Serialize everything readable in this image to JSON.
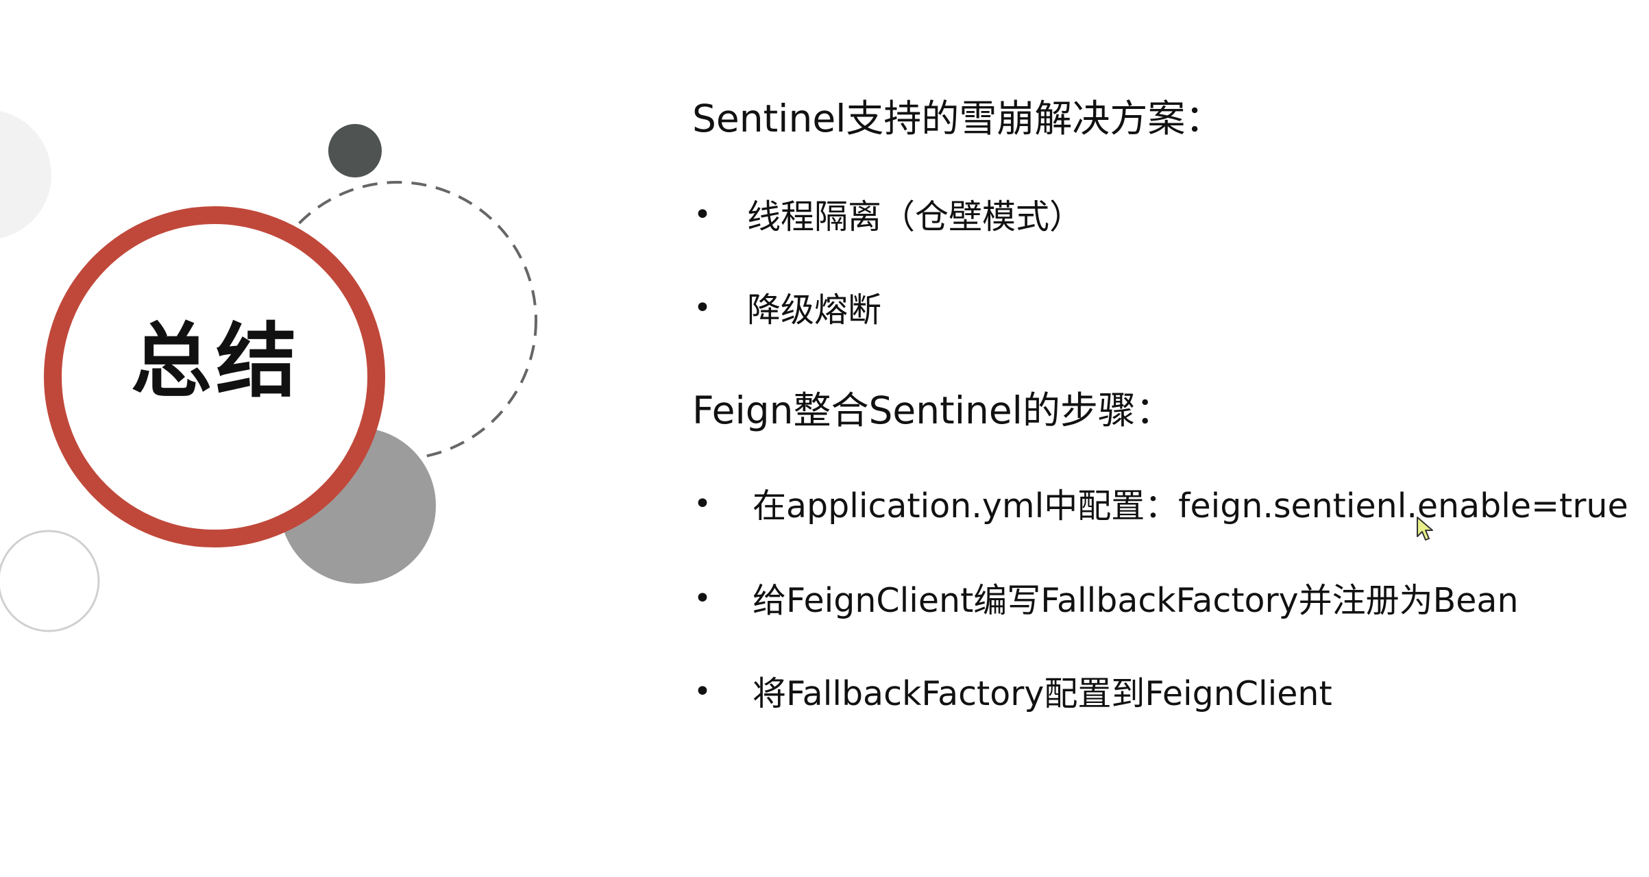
{
  "slide": {
    "title": "总结",
    "sections": [
      {
        "heading": "Sentinel支持的雪崩解决方案：",
        "items": [
          "线程隔离（仓壁模式）",
          "降级熔断"
        ]
      },
      {
        "heading": "Feign整合Sentinel的步骤：",
        "items": [
          "在application.yml中配置：feign.sentienl.enable=true",
          "给FeignClient编写FallbackFactory并注册为Bean",
          "将FallbackFactory配置到FeignClient"
        ]
      }
    ],
    "bullet": "•"
  },
  "colors": {
    "accent_ring": "#c0483a",
    "dark_dot": "#4f5352",
    "gray_circle": "#9c9c9c",
    "dashed_ring": "#666666",
    "light_circle": "#f2f2f2",
    "outline_circle": "#d0d0d0"
  },
  "icons": [
    "mouse-pointer-icon"
  ]
}
